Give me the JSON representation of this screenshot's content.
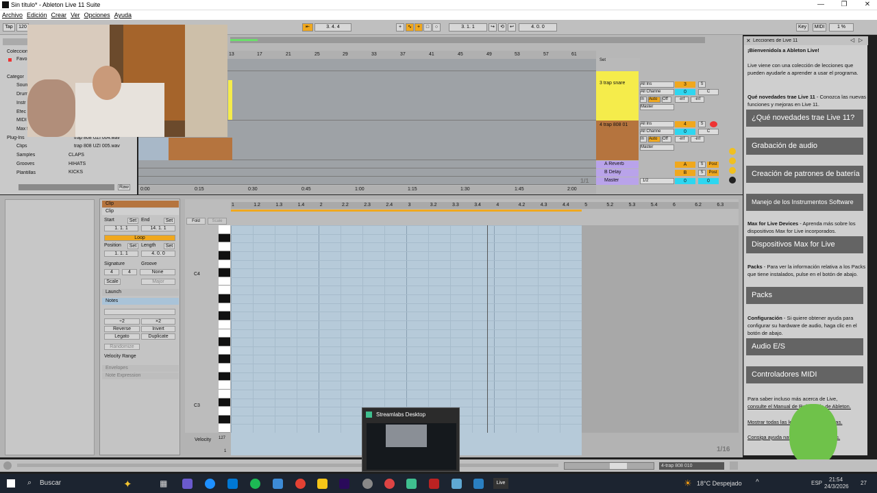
{
  "window": {
    "title": "Sin título* - Ableton Live 11 Suite"
  },
  "menu": [
    "Archivo",
    "Edición",
    "Crear",
    "Ver",
    "Opciones",
    "Ayuda"
  ],
  "control_bar": {
    "tap": "Tap",
    "tempo": "120",
    "arrangement_position": "3.  4.  4",
    "loop_start": "3.  1.  1",
    "loop_length": "4.  0.  0",
    "key_label": "Key",
    "midi_label": "MIDI",
    "cpu": "1 %"
  },
  "browser": {
    "collections_label": "Coleccion",
    "favorites_label": "Favo",
    "categories_label": "Categor",
    "places": [
      "Soun",
      "Drum",
      "Instr",
      "Efec",
      "MIDI",
      "Max f",
      "Plug-Ins",
      "Clips",
      "Samples",
      "Grooves",
      "Plantillas"
    ],
    "files": [
      "trap 808 UZI 004.wav",
      "trap 808 UZI 005.wav",
      "CLAPS",
      "HIHATS",
      "KICKS"
    ],
    "raw_label": "Raw"
  },
  "arrangement": {
    "ruler": [
      "13",
      "17",
      "21",
      "25",
      "29",
      "33",
      "37",
      "41",
      "45",
      "49",
      "53",
      "57",
      "61"
    ],
    "time_ruler": [
      "0:00",
      "0:15",
      "0:30",
      "0:45",
      "1:00",
      "1:15",
      "1:30",
      "1:45",
      "2:00"
    ],
    "page": "1/1",
    "set_label": "Set"
  },
  "mixer": {
    "tracks": [
      {
        "name": "3 trap snare",
        "color": "#f5ec4b",
        "input": "All Ins",
        "channel": "All Channe",
        "monitor": [
          "In",
          "Auto",
          "Off"
        ],
        "output": "Master",
        "number": "3",
        "solo": "S",
        "vol": "0",
        "pan": "C",
        "db1": "-inf",
        "db2": "-inf"
      },
      {
        "name": "4 trap 808 01",
        "color": "#b5743e",
        "input": "All Ins",
        "channel": "All Channe",
        "monitor": [
          "In",
          "Auto",
          "Off"
        ],
        "output": "Master",
        "number": "4",
        "solo": "S",
        "vol": "0",
        "pan": "C",
        "db1": "-inf",
        "db2": "-inf"
      }
    ],
    "returns": [
      {
        "name": "A Reverb",
        "letter": "A",
        "solo": "S",
        "post": "Post"
      },
      {
        "name": "B Delay",
        "letter": "B",
        "solo": "S",
        "post": "Post"
      }
    ],
    "master": {
      "name": "Master",
      "cue": "1/2",
      "vol": "0",
      "pan": "0"
    }
  },
  "clip_view": {
    "clip_title": "Clip",
    "clip_sub": "Clip",
    "start_label": "Start",
    "set": "Set",
    "end_label": "End",
    "start_value": "1.  1.  1",
    "end_value": "14.  1.  1",
    "loop": "Loop",
    "position_label": "Position",
    "length_label": "Length",
    "position_value": "1.  1.  1",
    "length_value": "4.  0.  0",
    "signature_label": "Signature",
    "groove_label": "Groove",
    "sig_num": "4",
    "sig_den": "4",
    "groove": "None",
    "scale": "Scale",
    "scale_major": "Major",
    "launch": "Launch",
    "notes": "Notes",
    "x2_half": "÷2",
    "x2_double": "×2",
    "reverse": "Reverse",
    "invert": "Invert",
    "legato": "Legato",
    "duplicate": "Duplicate",
    "randomize": "Randomize",
    "velocity_range": "Velocity Range",
    "envelopes": "Envelopes",
    "note_expression": "Note Expression"
  },
  "piano_roll": {
    "ruler": [
      "1",
      "1.2",
      "1.3",
      "1.4",
      "2",
      "2.2",
      "2.3",
      "2.4",
      "3",
      "3.2",
      "3.3",
      "3.4",
      "4",
      "4.2",
      "4.3",
      "4.4",
      "5",
      "5.2",
      "5.3",
      "5.4",
      "6",
      "6.2",
      "6.3"
    ],
    "fold": "Fold",
    "scale": "Scale",
    "c4": "C4",
    "c3": "C3",
    "velocity": "Velocity",
    "vel_max": "127",
    "vel_min": "1",
    "page": "1/16"
  },
  "help": {
    "header": "Lecciones de Live 11",
    "welcome": "¡Bienvenido/a a Ableton Live!",
    "intro": "Live viene con una colección de lecciones que pueden ayudarle a aprender a usar el programa.",
    "news_text_bold": "Qué novedades trae Live 11",
    "news_text": " - Conozca las nuevas funciones y mejoras en Live 11.",
    "btn_news": "¿Qué novedades trae Live 11?",
    "btn_audio": "Grabación de audio",
    "btn_drums": "Creación de patrones de batería",
    "btn_instruments": "Manejo de los Instrumentos Software",
    "max_bold": "Max for Live Devices",
    "max_text": " - Aprenda más sobre los dispositivos Max for Live incorporados.",
    "btn_max": "Dispositivos Max for Live",
    "packs_bold": "Packs",
    "packs_text": " - Para ver la información relativa a los Packs que tiene instalados, pulse en el botón de abajo.",
    "btn_packs": "Packs",
    "config_bold": "Configuración",
    "config_text": " - Si quiere obtener ayuda para configurar su hardware de audio, haga clic en el botón de abajo.",
    "btn_audio_io": "Audio E/S",
    "btn_midi": "Controladores MIDI",
    "more_1": "Para saber incluso más acerca de Live,",
    "more_2": "consulte el Manual de Referencia de Ableton.",
    "show_all": "Mostrar todas las lecciones incorporadas.",
    "get_help": "Consiga ayuda navegando en lecciones."
  },
  "status_bar": {
    "track": "4-trap 808 010"
  },
  "taskbar": {
    "search": "Buscar",
    "popup_title": "Streamlabs Desktop",
    "weather": "18°C  Despejado",
    "lang": "ESP",
    "time": "21:54",
    "date": "24/3/2026",
    "notif": "27",
    "live_label": "Live"
  }
}
